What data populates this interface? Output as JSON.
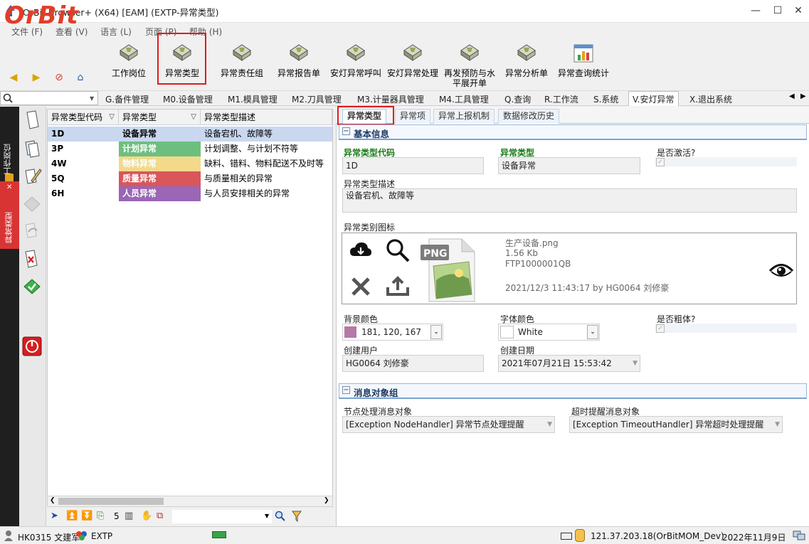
{
  "window": {
    "title": "OrBit Browser+ (X64) [EAM] (EXTP-异常类型)"
  },
  "menu": [
    "文件 (F)",
    "查看 (V)",
    "语言 (L)",
    "页面 (P)",
    "帮助 (H)"
  ],
  "logo": "OrBit",
  "toolbar": [
    "工作岗位",
    "异常类型",
    "异常责任组",
    "异常报告单",
    "安灯异常呼叫",
    "安灯异常处理",
    "再发预防与水",
    "平展开单",
    "异常分析单",
    "异常查询统计"
  ],
  "module_tabs": [
    "G.备件管理",
    "M0.设备管理",
    "M1.模具管理",
    "M2.刀具管理",
    "M3.计量器具管理",
    "M4.工具管理",
    "Q.查询",
    "R.工作流",
    "S.系统",
    "V.安灯异常",
    "X.退出系统"
  ],
  "side_tabs": {
    "work_post": "工作岗位",
    "exception_type": "异常类型"
  },
  "grid": {
    "headers": [
      "异常类型代码",
      "异常类型",
      "异常类型描述"
    ],
    "rows": [
      {
        "code": "1D",
        "type": "设备异常",
        "desc": "设备宕机、故障等",
        "color": ""
      },
      {
        "code": "3P",
        "type": "计划异常",
        "desc": "计划调整、与计划不符等",
        "color": "#6dbf7f"
      },
      {
        "code": "4W",
        "type": "物料异常",
        "desc": "缺料、错料、物料配送不及时等",
        "color": "#f3d98a"
      },
      {
        "code": "5Q",
        "type": "质量异常",
        "desc": "与质量相关的异常",
        "color": "#d9565b"
      },
      {
        "code": "6H",
        "type": "人员异常",
        "desc": "与人员安排相关的异常",
        "color": "#9a66b5"
      }
    ],
    "count": "5"
  },
  "detail_tabs": [
    "异常类型",
    "异常项",
    "异常上报机制",
    "数据修改历史"
  ],
  "basic": {
    "group_title": "基本信息",
    "code_label": "异常类型代码",
    "code": "1D",
    "type_label": "异常类型",
    "type": "设备异常",
    "active_label": "是否激活?",
    "desc_label": "异常类型描述",
    "desc": "设备宕机、故障等",
    "icon_label": "异常类别图标",
    "file_name": "生产设备.png",
    "file_size": "1.56 Kb",
    "file_id": "FTP1000001QB",
    "file_meta": "2021/12/3  11:43:17  by  HG0064 刘修豪",
    "bg_label": "背景颜色",
    "bg_value": "181, 120, 167",
    "bg_color": "#b578a7",
    "font_label": "字体颜色",
    "font_value": "White",
    "bold_label": "是否粗体?",
    "user_label": "创建用户",
    "user": "HG0064 刘修豪",
    "date_label": "创建日期",
    "date": "2021年07月21日 15:53:42"
  },
  "msg": {
    "group_title": "消息对象组",
    "node_label": "节点处理消息对象",
    "node_value": "[Exception NodeHandler] 异常节点处理提醒",
    "timeout_label": "超时提醒消息对象",
    "timeout_value": "[Exception TimeoutHandler] 异常超时处理提醒"
  },
  "status": {
    "user": "HK0315 文建军",
    "db": "EXTP",
    "server": "121.37.203.18(OrBitMOM_Dev)",
    "date": "2022年11月9日"
  }
}
